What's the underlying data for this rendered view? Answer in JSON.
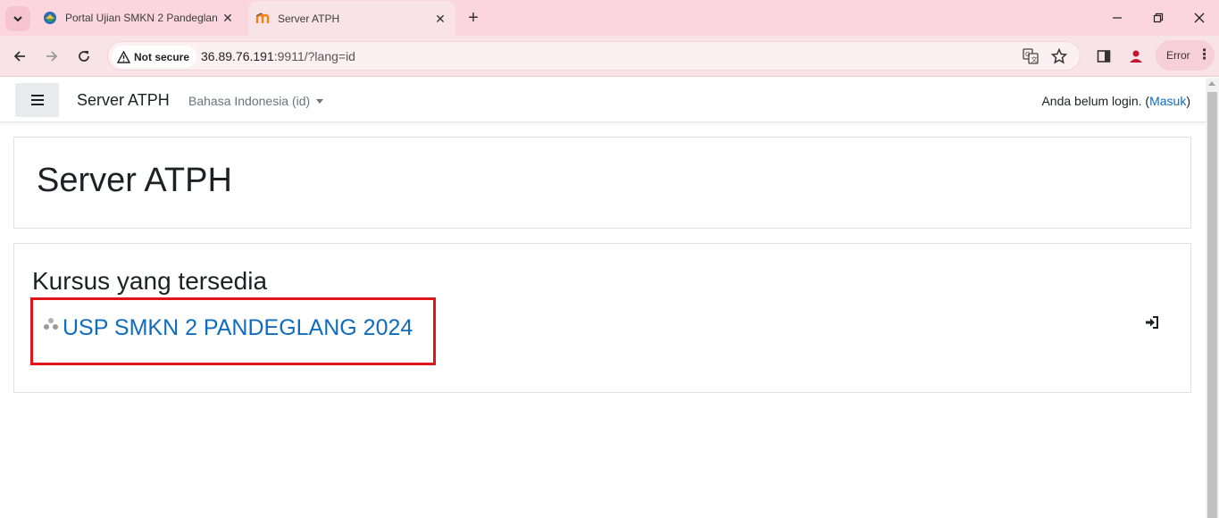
{
  "browser": {
    "tabs": [
      {
        "title": "Portal Ujian SMKN 2 Pandeglang",
        "active": false,
        "favicon": "school-logo-icon"
      },
      {
        "title": "Server ATPH",
        "active": true,
        "favicon": "moodle-icon"
      }
    ],
    "security_label": "Not secure",
    "url_host": "36.89.76.191",
    "url_rest": ":9911/?lang=id",
    "profile_status": "Error"
  },
  "page": {
    "site_name": "Server ATPH",
    "language_selector": "Bahasa Indonesia (id)",
    "login_text": "Anda belum login. (",
    "login_link": "Masuk",
    "login_close": ")",
    "heading": "Server ATPH",
    "courses_heading": "Kursus yang tersedia",
    "courses": [
      {
        "name": "USP SMKN 2 PANDEGLANG 2024",
        "enrol_icon": "sign-in-icon"
      }
    ]
  },
  "colors": {
    "link": "#0f6cbf",
    "highlight": "#e0141b",
    "tabstrip": "#fbd6de"
  }
}
